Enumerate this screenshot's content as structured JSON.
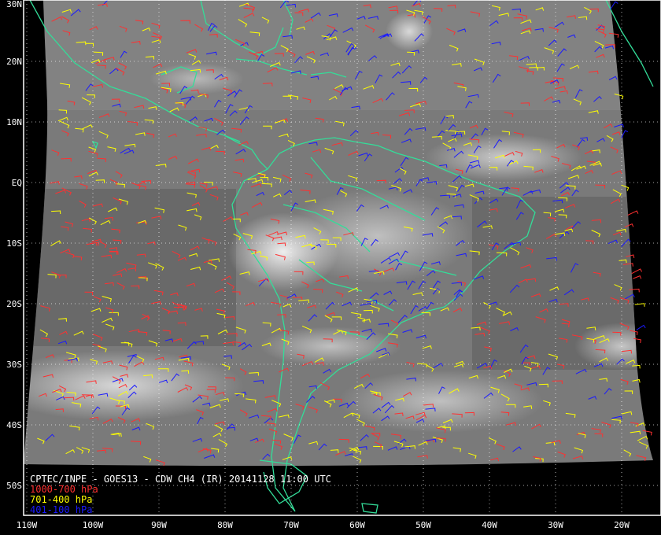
{
  "title": "CPTEC/INPE - GOES13 - CDW CH4 (IR) 20141128 11:00 UTC",
  "legend": [
    {
      "label": "1000-700 hPa",
      "color": "#ff3030"
    },
    {
      "label": "701-400 hPa",
      "color": "#ffff00"
    },
    {
      "label": "401-100 hPa",
      "color": "#1a1aff"
    }
  ],
  "latitude_labels": [
    "30N",
    "20N",
    "10N",
    "EQ",
    "10S",
    "20S",
    "30S",
    "40S",
    "50S"
  ],
  "longitude_labels": [
    "110W",
    "100W",
    "90W",
    "80W",
    "70W",
    "60W",
    "50W",
    "40W",
    "30W",
    "20W"
  ],
  "colors": {
    "coastline": "#33dd99",
    "grid": "#ffffff",
    "background": "#000000",
    "cloud_imagery": "#808080"
  }
}
